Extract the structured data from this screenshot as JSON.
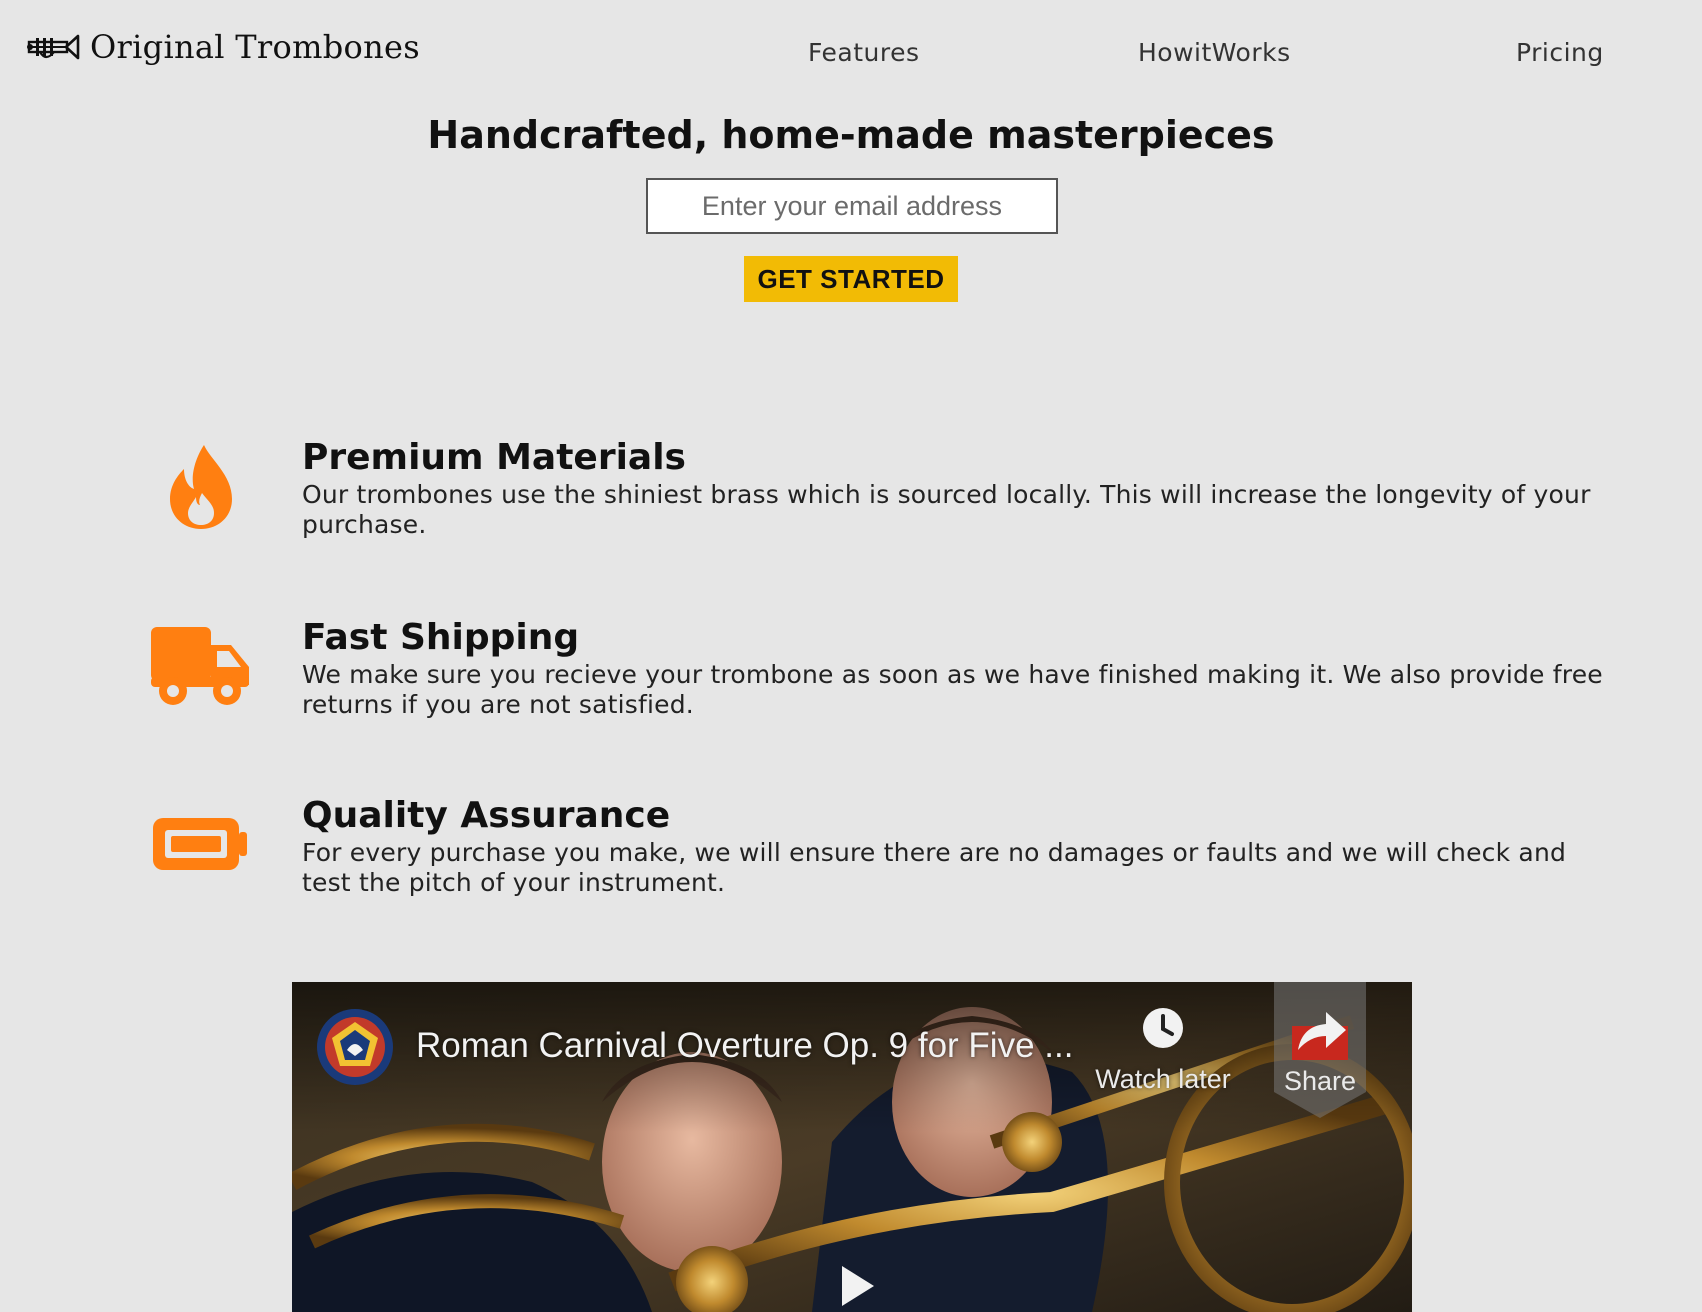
{
  "brand": {
    "name": "Original Trombones",
    "logo_icon": "trombone-icon"
  },
  "nav": {
    "items": [
      {
        "label": "Features"
      },
      {
        "label": "HowitWorks"
      },
      {
        "label": "Pricing"
      }
    ]
  },
  "hero": {
    "title": "Handcrafted, home-made masterpieces",
    "email_placeholder": "Enter your email address",
    "cta_label": "GET STARTED"
  },
  "features": [
    {
      "icon": "fire-icon",
      "title": "Premium Materials",
      "description": "Our trombones use the shiniest brass which is sourced locally. This will increase the longevity of your purchase."
    },
    {
      "icon": "truck-icon",
      "title": "Fast Shipping",
      "description": "We make sure you recieve your trombone as soon as we have finished making it. We also provide free returns if you are not satisfied."
    },
    {
      "icon": "battery-full-icon",
      "title": "Quality Assurance",
      "description": "For every purchase you make, we will ensure there are no damages or faults and we will check and test the pitch of your instrument."
    }
  ],
  "video": {
    "title": "Roman Carnival Overture Op. 9 for Five ...",
    "watch_later_label": "Watch later",
    "share_label": "Share"
  },
  "colors": {
    "accent_orange": "#ff7f11",
    "cta_yellow": "#f2bb05",
    "background": "#e6e6e6"
  }
}
